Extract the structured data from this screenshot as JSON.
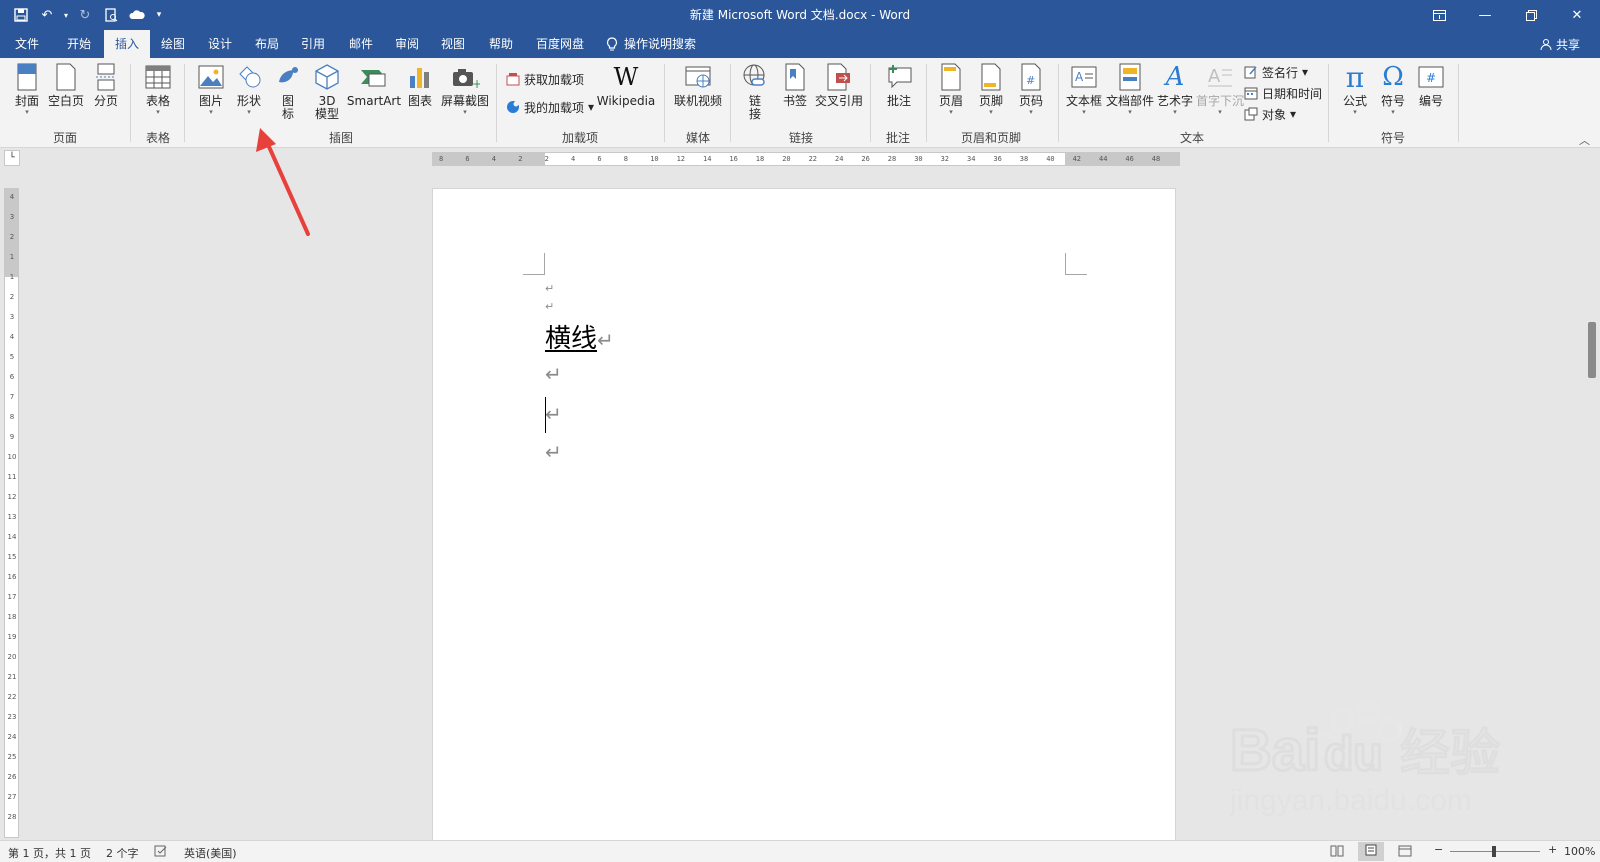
{
  "window": {
    "title": "新建 Microsoft Word 文档.docx  -  Word"
  },
  "tabs": [
    "文件",
    "开始",
    "插入",
    "绘图",
    "设计",
    "布局",
    "引用",
    "邮件",
    "审阅",
    "视图",
    "帮助",
    "百度网盘"
  ],
  "active_tab": "插入",
  "tell_me": "操作说明搜索",
  "share": "共享",
  "ribbon": {
    "page": {
      "cover": "封面",
      "blank": "空白页",
      "break": "分页",
      "group": "页面"
    },
    "table": {
      "table": "表格",
      "group": "表格"
    },
    "illustrations": {
      "pictures": "图片",
      "shapes": "形状",
      "icons_1": "图",
      "icons_2": "标",
      "model_1": "3D",
      "model_2": "模型",
      "smartart": "SmartArt",
      "chart": "图表",
      "screenshot": "屏幕截图",
      "group": "插图"
    },
    "addins": {
      "get": "获取加载项",
      "mine": "我的加载项",
      "wikipedia": "Wikipedia",
      "group": "加载项"
    },
    "media": {
      "video": "联机视频",
      "group": "媒体"
    },
    "links": {
      "link_1": "链",
      "link_2": "接",
      "bookmark": "书签",
      "crossref": "交叉引用",
      "group": "链接"
    },
    "comments": {
      "comment": "批注",
      "group": "批注"
    },
    "headerfooter": {
      "header": "页眉",
      "footer": "页脚",
      "pagenum": "页码",
      "group": "页眉和页脚"
    },
    "text": {
      "textbox": "文本框",
      "quickparts": "文档部件",
      "wordart": "艺术字",
      "dropcap": "首字下沉",
      "signature": "签名行",
      "datetime": "日期和时间",
      "object": "对象",
      "group": "文本"
    },
    "symbols": {
      "equation": "公式",
      "symbol": "符号",
      "number": "编号",
      "group": "符号"
    }
  },
  "icons": {
    "pi": "π",
    "omega": "Ω",
    "wiki": "W",
    "wordart": "A",
    "hash": "#"
  },
  "ruler_ticks": [
    "8",
    "6",
    "4",
    "2",
    "2",
    "4",
    "6",
    "8",
    "10",
    "12",
    "14",
    "16",
    "18",
    "20",
    "22",
    "24",
    "26",
    "28",
    "30",
    "32",
    "34",
    "36",
    "38",
    "40",
    "42",
    "44",
    "46",
    "48"
  ],
  "vruler_ticks": [
    "4",
    "3",
    "2",
    "1",
    "1",
    "2",
    "3",
    "4",
    "5",
    "6",
    "7",
    "8",
    "9",
    "10",
    "11",
    "12",
    "13",
    "14",
    "15",
    "16",
    "17",
    "18",
    "19",
    "20",
    "21",
    "22",
    "23",
    "24",
    "25",
    "26",
    "27",
    "28"
  ],
  "document": {
    "heading": "横线",
    "para_mark": "↵"
  },
  "status": {
    "page": "第 1 页，共 1 页",
    "words": "2 个字",
    "language": "英语(美国)",
    "zoom": "100%"
  },
  "watermark": {
    "brand": "Bai",
    "brand2": "du",
    "cn": "经验",
    "url": "jingyan.baidu.com"
  },
  "colors": {
    "accent": "#2b579a",
    "arrow": "#e8403a"
  }
}
